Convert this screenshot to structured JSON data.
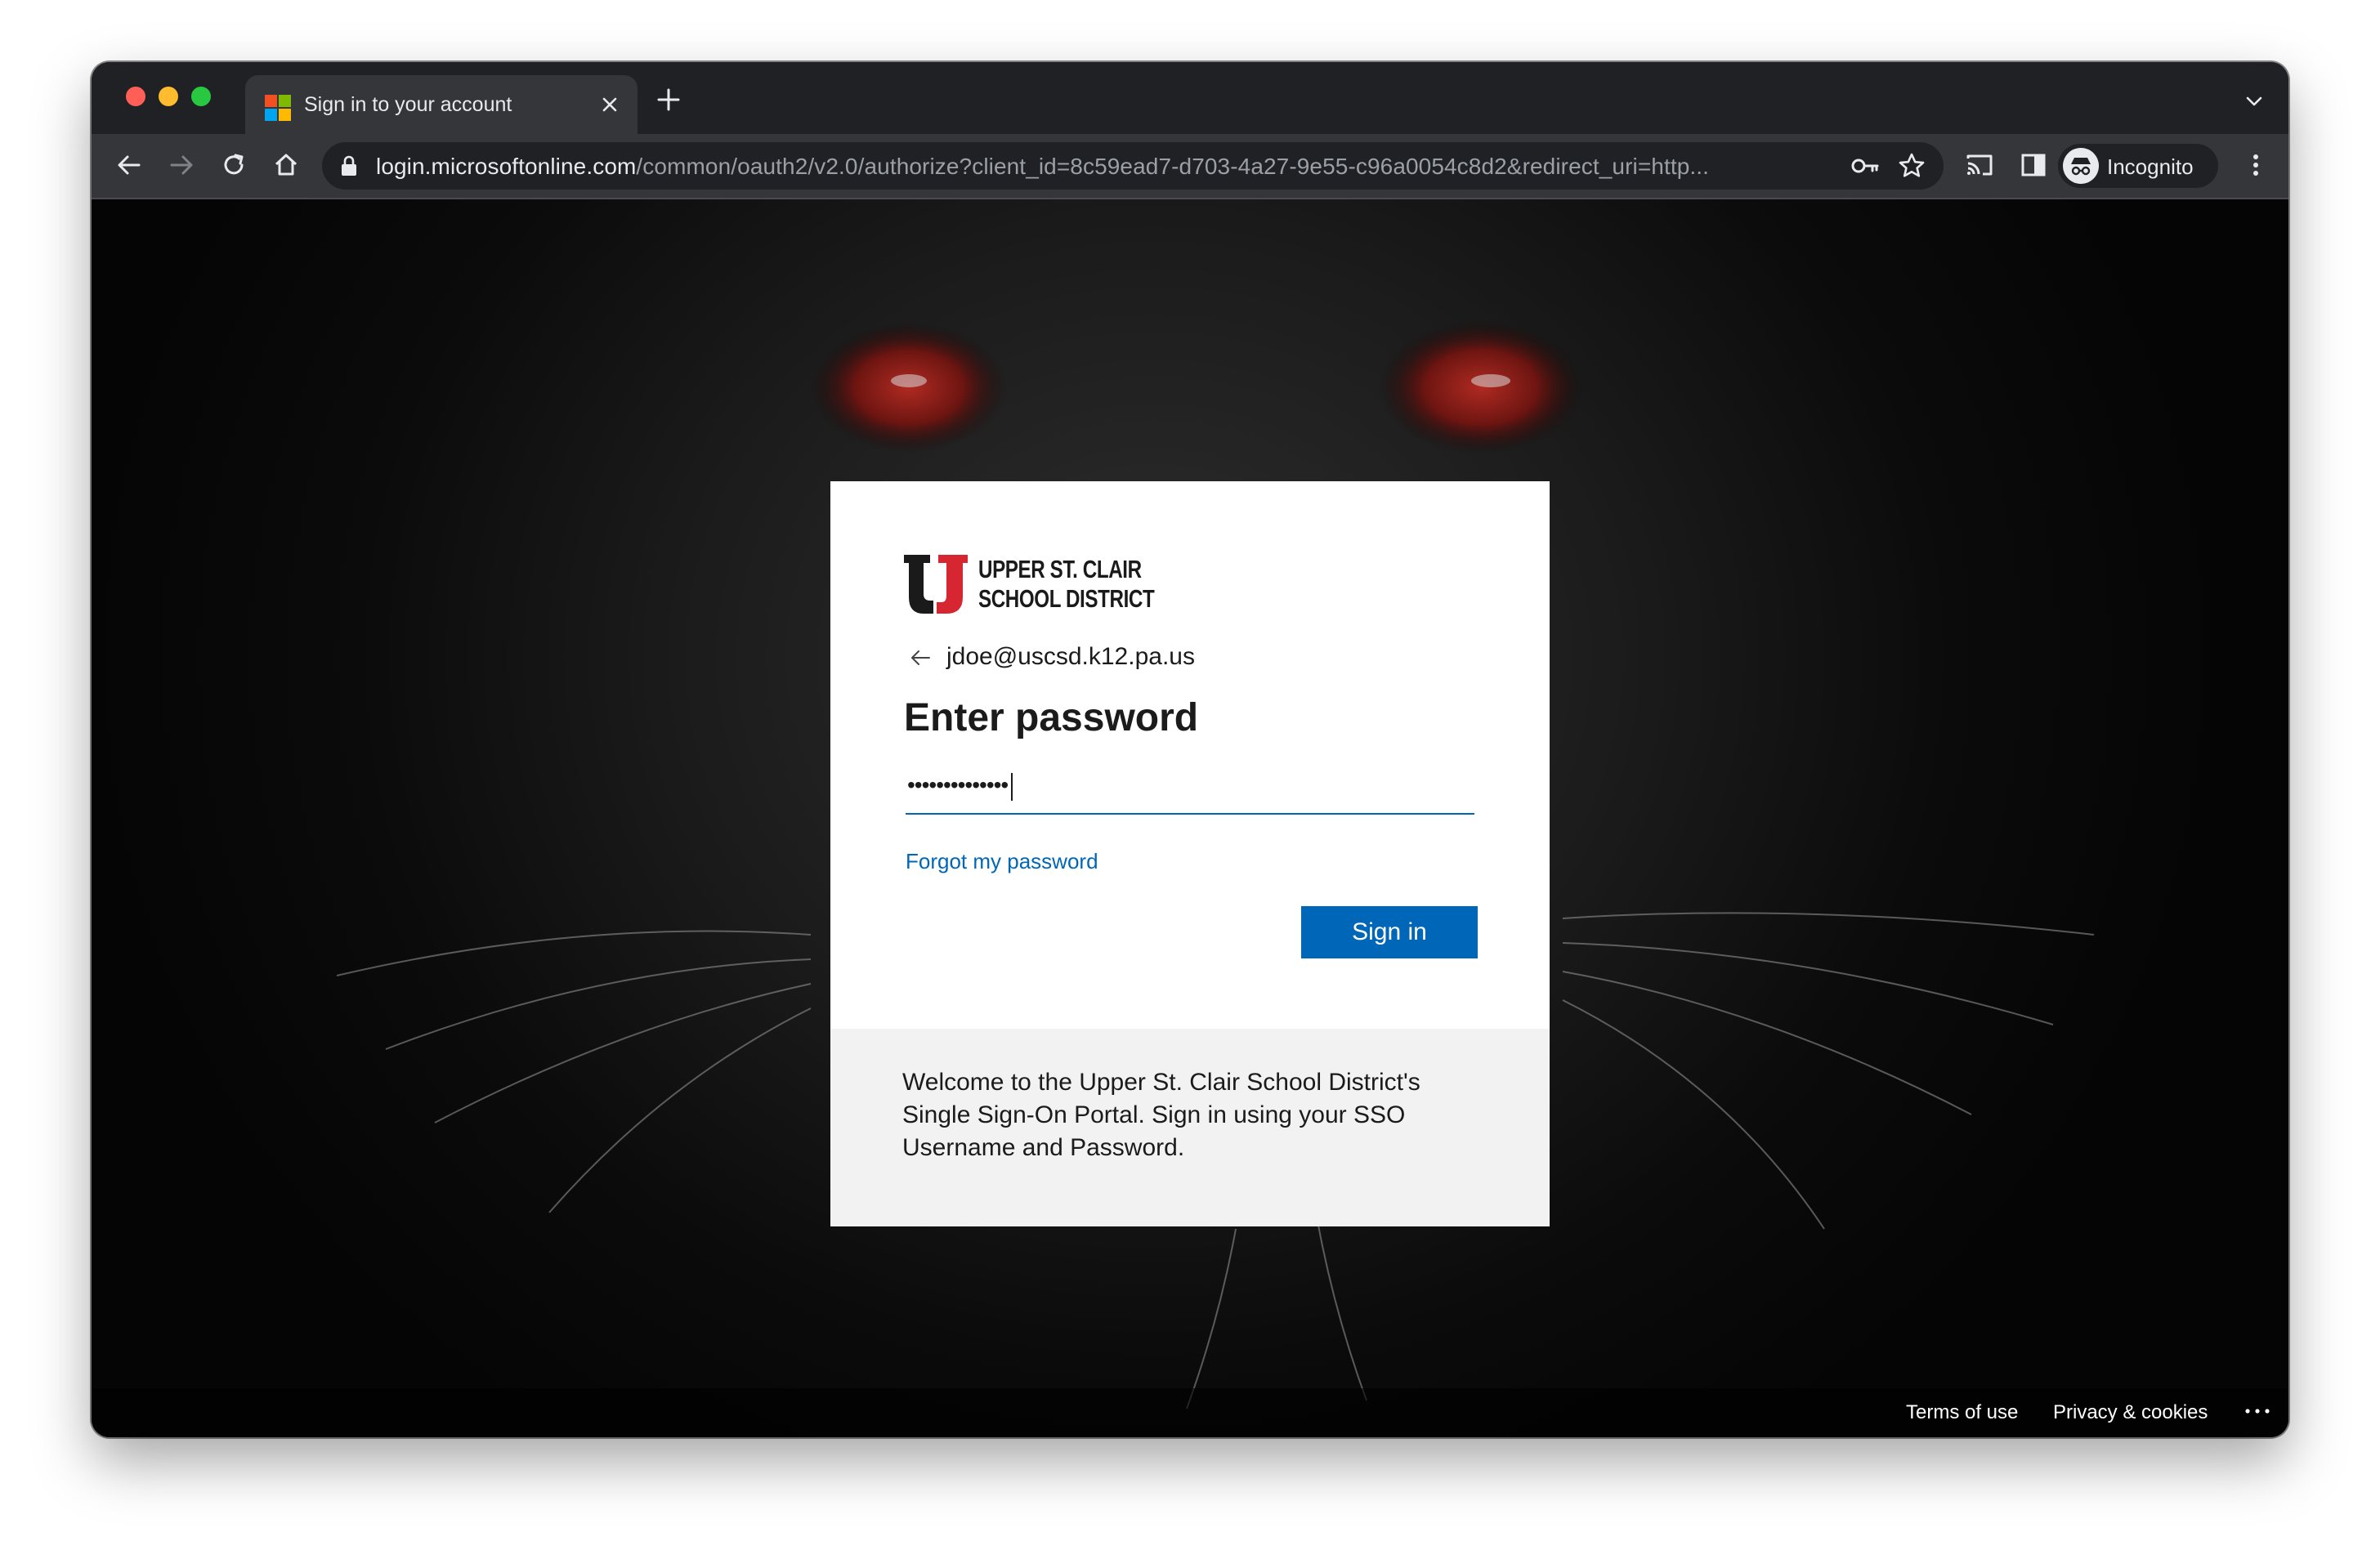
{
  "browser": {
    "tab": {
      "title": "Sign in to your account"
    },
    "address_bar": {
      "host": "login.microsoftonline.com",
      "path": "/common/oauth2/v2.0/authorize?client_id=8c59ead7-d703-4a27-9e55-c96a0054c8d2&redirect_uri=http..."
    },
    "profile_label": "Incognito"
  },
  "signin_card": {
    "logo_text": {
      "line1": "UPPER ST. CLAIR",
      "line2": "SCHOOL DISTRICT"
    },
    "identity": "jdoe@uscsd.k12.pa.us",
    "title": "Enter password",
    "password_value": "••••••••••••••",
    "forgot_link": "Forgot my password",
    "signin_button": "Sign in",
    "welcome_text": "Welcome to the Upper St. Clair School District's Single Sign-On Portal. Sign in using your SSO Username and Password."
  },
  "footer": {
    "terms": "Terms of use",
    "privacy": "Privacy & cookies",
    "more": "..."
  },
  "colors": {
    "accent": "#0067b8",
    "logo_red": "#d62631",
    "logo_black": "#1a1a1a"
  }
}
